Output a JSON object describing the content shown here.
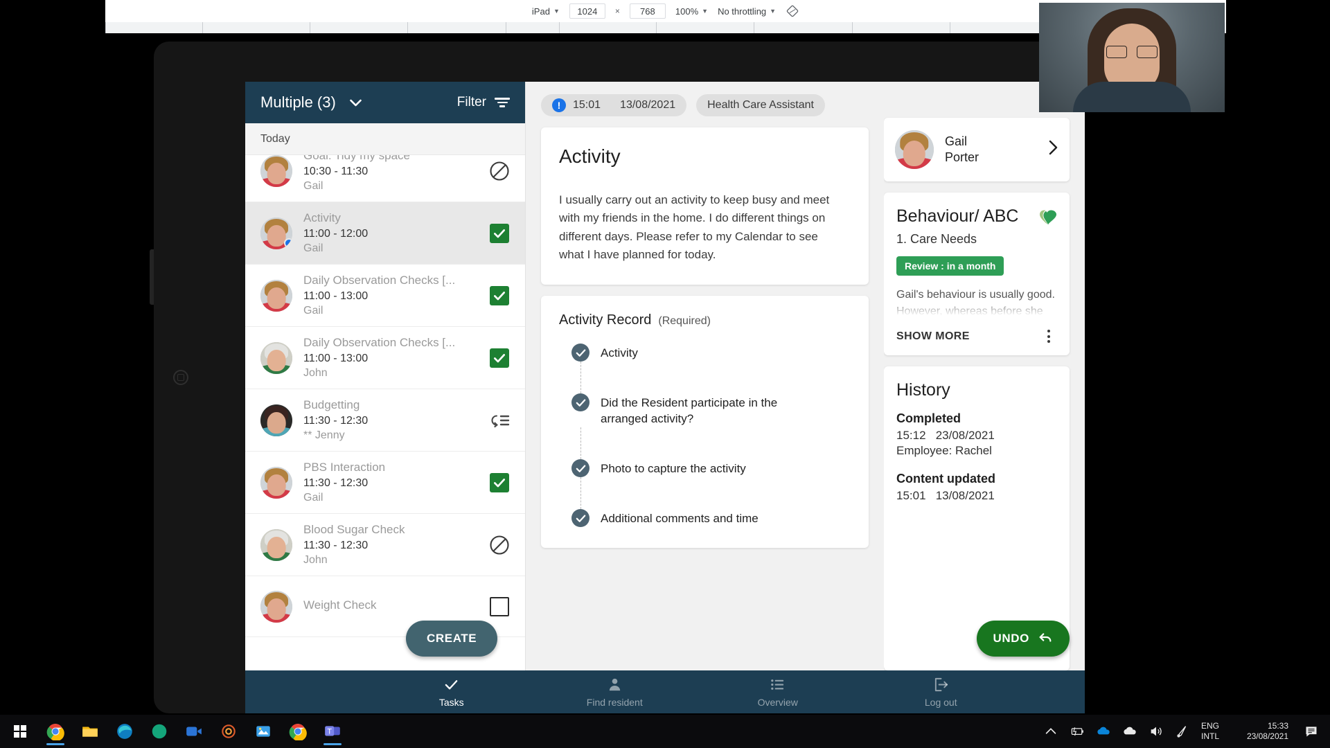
{
  "devtools": {
    "device": "iPad",
    "width": "1024",
    "height": "768",
    "x_symbol": "×",
    "zoom": "100%",
    "throttling": "No throttling",
    "rotate_icon": "rotate-device-icon",
    "caret": "▼"
  },
  "left_panel": {
    "title": "Multiple (3)",
    "title_caret": "chevron-down-icon",
    "filter_label": "Filter",
    "filter_icon": "filter-icon",
    "section_label": "Today",
    "create_label": "CREATE",
    "tasks": [
      {
        "name": "Goal: Tidy my space",
        "time": "10:30 - 11:30",
        "person": "Gail",
        "icon": "block-icon",
        "avatar": "gail",
        "selected": false,
        "badge": false
      },
      {
        "name": "Activity",
        "time": "11:00 - 12:00",
        "person": "Gail",
        "icon": "check-green",
        "avatar": "gail",
        "selected": true,
        "badge": true
      },
      {
        "name": "Daily Observation Checks [...",
        "time": "11:00 - 13:00",
        "person": "Gail",
        "icon": "check-green",
        "avatar": "gail",
        "selected": false,
        "badge": false
      },
      {
        "name": "Daily Observation Checks [...",
        "time": "11:00 - 13:00",
        "person": "John",
        "icon": "check-green",
        "avatar": "john",
        "selected": false,
        "badge": false
      },
      {
        "name": "Budgetting",
        "time": "11:30 - 12:30",
        "person": "** Jenny",
        "icon": "repeat-list-icon",
        "avatar": "jenny",
        "selected": false,
        "badge": false
      },
      {
        "name": "PBS Interaction",
        "time": "11:30 - 12:30",
        "person": "Gail",
        "icon": "check-green",
        "avatar": "gail",
        "selected": false,
        "badge": false
      },
      {
        "name": "Blood Sugar Check",
        "time": "11:30 - 12:30",
        "person": "John",
        "icon": "block-icon",
        "avatar": "john",
        "selected": false,
        "badge": false
      },
      {
        "name": "Weight Check",
        "time": "",
        "person": "",
        "icon": "checkbox-empty",
        "avatar": "gail",
        "selected": false,
        "badge": false
      }
    ]
  },
  "center": {
    "chips": [
      {
        "icon": "alert-icon",
        "icon_glyph": "!",
        "time": "15:01",
        "date": "13/08/2021"
      },
      {
        "label": "Health Care Assistant"
      }
    ],
    "activity_card": {
      "title": "Activity",
      "body": "I usually carry out an activity to keep busy and meet with my friends in the home. I do different things on different days. Please refer to my Calendar to see what I have planned for today."
    },
    "record_card": {
      "title": "Activity Record",
      "required": "(Required)",
      "steps": [
        {
          "label": "Activity",
          "checked": true
        },
        {
          "label": "Did the Resident participate in the arranged activity?",
          "checked": true
        },
        {
          "label": "Photo to capture the activity",
          "checked": true
        },
        {
          "label": "Additional comments and time",
          "checked": true
        }
      ]
    }
  },
  "right": {
    "person": {
      "first_name": "Gail",
      "last_name": "Porter",
      "chevron": "chevron-right-icon",
      "avatar": "gail"
    },
    "behaviour": {
      "title": "Behaviour/ ABC",
      "icon": "health-heart-icon",
      "subtitle": "1. Care Needs",
      "badge": "Review : in a month",
      "text_line1": "Gail's behaviour is usually good.",
      "text_line2": "However, whereas before she would",
      "show_more": "SHOW MORE",
      "menu_icon": "kebab-menu-icon"
    },
    "history": {
      "title": "History",
      "entries": [
        {
          "heading": "Completed",
          "time": "15:12",
          "date": "23/08/2021",
          "extra": "Employee: Rachel"
        },
        {
          "heading": "Content updated",
          "time": "15:01",
          "date": "13/08/2021",
          "extra": ""
        }
      ]
    },
    "undo_label": "UNDO",
    "undo_icon": "undo-arrow-icon"
  },
  "bottom_nav": [
    {
      "label": "Tasks",
      "icon": "check-icon",
      "active": true
    },
    {
      "label": "Find resident",
      "icon": "person-icon",
      "active": false
    },
    {
      "label": "Overview",
      "icon": "list-icon",
      "active": false
    },
    {
      "label": "Log out",
      "icon": "logout-icon",
      "active": false
    }
  ],
  "taskbar": {
    "start_icon": "windows-start-icon",
    "apps": [
      {
        "name": "chrome-taskbar-icon",
        "active": true
      },
      {
        "name": "file-explorer-taskbar-icon",
        "active": false
      },
      {
        "name": "edge-taskbar-icon",
        "active": false
      },
      {
        "name": "circle-green-taskbar-icon",
        "active": false
      },
      {
        "name": "video-call-taskbar-icon",
        "active": false
      },
      {
        "name": "spiral-taskbar-icon",
        "active": false
      },
      {
        "name": "photos-taskbar-icon",
        "active": false
      },
      {
        "name": "chrome2-taskbar-icon",
        "active": false
      },
      {
        "name": "teams-taskbar-icon",
        "active": true
      }
    ],
    "tray": {
      "chevron": "show-hidden-icons-icon",
      "battery": "battery-charging-icon",
      "onedrive_blue": "onedrive-blue-icon",
      "onedrive_white": "onedrive-white-icon",
      "volume": "volume-icon",
      "pen": "pen-icon",
      "lang_line1": "ENG",
      "lang_line2": "INTL",
      "time": "15:33",
      "date": "23/08/2021",
      "notifications": "notifications-icon"
    }
  },
  "colors": {
    "header_navy": "#1d3e53",
    "green_check": "#1d8032",
    "green_undo": "#18761f",
    "green_badge": "#2e9e56",
    "slate_create": "#42646f",
    "step_dot": "#4d6472",
    "alert_blue": "#1a73e8"
  }
}
